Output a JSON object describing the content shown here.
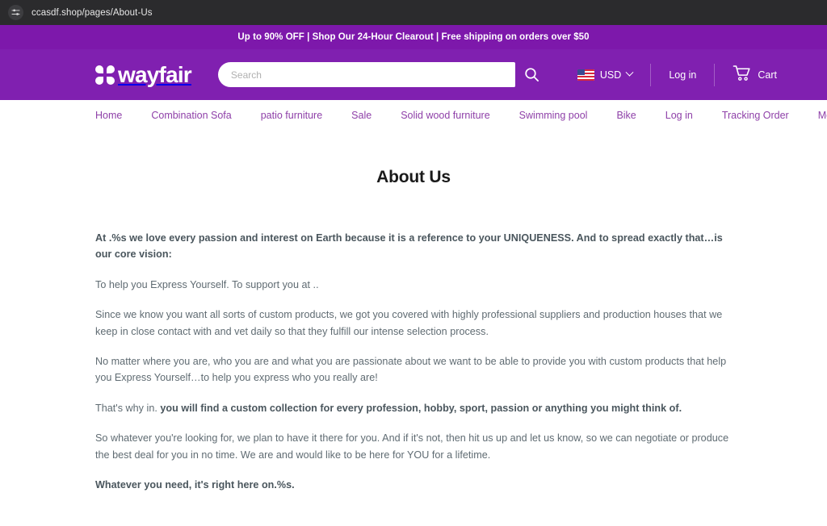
{
  "browser": {
    "url": "ccasdf.shop/pages/About-Us",
    "site_settings_icon": "site-settings-icon"
  },
  "announcement": {
    "text": "Up to 90% OFF | Shop Our 24-Hour Clearout | Free shipping on orders over $50"
  },
  "header": {
    "logo_text": "wayfair",
    "logo_mark_icon": "wayfair-petal-logo-icon",
    "search": {
      "placeholder": "Search",
      "value": "",
      "submit_icon": "search-icon"
    },
    "currency": {
      "flag_icon": "us-flag-icon",
      "label": "USD",
      "chevron_icon": "chevron-down-icon"
    },
    "login_label": "Log in",
    "cart": {
      "icon": "shopping-cart-icon",
      "label": "Cart"
    }
  },
  "nav": {
    "items": [
      {
        "label": "Home"
      },
      {
        "label": "Combination Sofa"
      },
      {
        "label": "patio furniture"
      },
      {
        "label": "Sale"
      },
      {
        "label": "Solid wood furniture"
      },
      {
        "label": "Swimming pool"
      },
      {
        "label": "Bike"
      },
      {
        "label": "Log in"
      },
      {
        "label": "Tracking Order"
      },
      {
        "label": "More Links"
      }
    ]
  },
  "main": {
    "title": "About Us",
    "paragraphs": [
      "At .%s we love every passion and interest on Earth because it is a reference to your UNIQUENESS. And to spread exactly that…is our core vision:",
      "To help you Express Yourself. To support you at ..",
      "Since we know you want all sorts of custom products, we got you covered with highly professional suppliers and production houses that we keep in close contact with and vet daily so that they fulfill our intense selection process.",
      "No matter where you are, who you are and what you are passionate about we want to be able to provide you with custom products that help you Express Yourself…to help you express who you really are!",
      "That's why in. ",
      "So whatever you're looking for, we plan to have it there for you. And if it's not, then hit us up and let us know, so we can negotiate or produce the best deal for you in no time. We are and would like to be here for YOU for a lifetime.",
      "Whatever you need, it's right here on.%s."
    ],
    "para5_bold": "you will find a custom collection for every profession, hobby, sport, passion or anything you might think of."
  },
  "colors": {
    "announcement_bg": "#7d18ab",
    "header_bg": "#8020b0",
    "nav_link": "#8e3fa8",
    "browser_bg": "#2b2b2d",
    "body_text": "#5f6b72"
  }
}
